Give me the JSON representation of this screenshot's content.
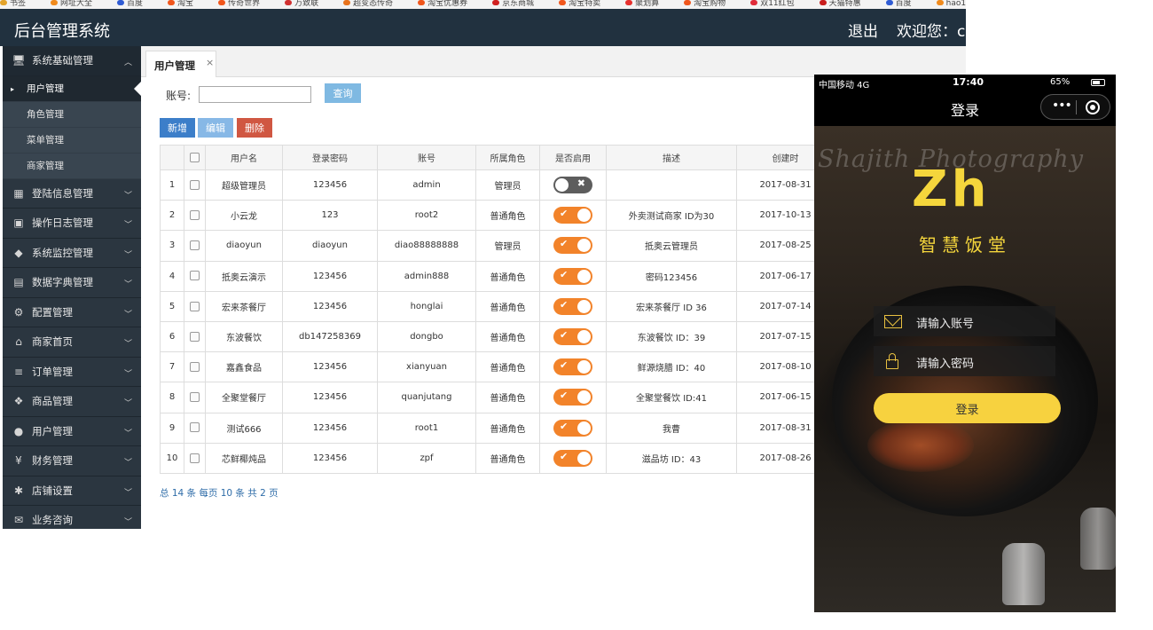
{
  "bookmarks": [
    {
      "label": "书签",
      "color": "#e3a32a"
    },
    {
      "label": "网址大全",
      "color": "#f08a1c"
    },
    {
      "label": "百度",
      "color": "#2f5bd3"
    },
    {
      "label": "淘宝",
      "color": "#f0561c"
    },
    {
      "label": "传奇世界",
      "color": "#f0561c"
    },
    {
      "label": "万致联",
      "color": "#d03030"
    },
    {
      "label": "超变态传奇",
      "color": "#e9731c"
    },
    {
      "label": "淘宝优惠券",
      "color": "#f0561c"
    },
    {
      "label": "京东商城",
      "color": "#d02020"
    },
    {
      "label": "淘宝特卖",
      "color": "#f0561c"
    },
    {
      "label": "聚划算",
      "color": "#e6302d"
    },
    {
      "label": "淘宝购物",
      "color": "#f0561c"
    },
    {
      "label": "双11红包",
      "color": "#e02b3a"
    },
    {
      "label": "天猫特惠",
      "color": "#c81d1d"
    },
    {
      "label": "百度",
      "color": "#2f5bd3"
    },
    {
      "label": "hao123导航",
      "color": "#f08a1c"
    }
  ],
  "header": {
    "title": "后台管理系统",
    "logout": "退出",
    "welcome": "欢迎您：c"
  },
  "sidebar": {
    "groups": [
      {
        "label": "系统基础管理",
        "icon": "monitor-icon",
        "glyph": "🖥",
        "open": true,
        "items": [
          {
            "label": "用户管理",
            "active": true
          },
          {
            "label": "角色管理"
          },
          {
            "label": "菜单管理"
          },
          {
            "label": "商家管理"
          }
        ]
      },
      {
        "label": "登陆信息管理",
        "icon": "calendar-icon",
        "glyph": "▦"
      },
      {
        "label": "操作日志管理",
        "icon": "image-icon",
        "glyph": "▣"
      },
      {
        "label": "系统监控管理",
        "icon": "tag-icon",
        "glyph": "◆"
      },
      {
        "label": "数据字典管理",
        "icon": "book-icon",
        "glyph": "▤"
      },
      {
        "label": "配置管理",
        "icon": "gear-icon",
        "glyph": "⚙"
      },
      {
        "label": "商家首页",
        "icon": "home-icon",
        "glyph": "⌂"
      },
      {
        "label": "订单管理",
        "icon": "list-icon",
        "glyph": "≡"
      },
      {
        "label": "商品管理",
        "icon": "cubes-icon",
        "glyph": "❖"
      },
      {
        "label": "用户管理",
        "icon": "user-icon",
        "glyph": "●"
      },
      {
        "label": "财务管理",
        "icon": "yen-icon",
        "glyph": "¥"
      },
      {
        "label": "店铺设置",
        "icon": "asterisk-icon",
        "glyph": "✱"
      },
      {
        "label": "业务咨询",
        "icon": "chat-icon",
        "glyph": "✉"
      }
    ]
  },
  "tab": {
    "label": "用户管理",
    "close": "×"
  },
  "search": {
    "label": "账号:",
    "value": "",
    "button": "查询"
  },
  "toolbar": {
    "add": "新增",
    "edit": "编辑",
    "delete": "删除"
  },
  "table": {
    "headers": [
      "",
      "",
      "用户名",
      "登录密码",
      "账号",
      "所属角色",
      "是否启用",
      "描述",
      "创建时"
    ],
    "rows": [
      {
        "no": "1",
        "username": "超级管理员",
        "password": "123456",
        "account": "admin",
        "role": "管理员",
        "enabled": false,
        "desc": "",
        "created": "2017-08-31"
      },
      {
        "no": "2",
        "username": "小云龙",
        "password": "123",
        "account": "root2",
        "role": "普通角色",
        "enabled": true,
        "desc": "外卖测试商家 ID为30",
        "created": "2017-10-13"
      },
      {
        "no": "3",
        "username": "diaoyun",
        "password": "diaoyun",
        "account": "diao88888888",
        "role": "管理员",
        "enabled": true,
        "desc": "抵奥云管理员",
        "created": "2017-08-25"
      },
      {
        "no": "4",
        "username": "抵奥云演示",
        "password": "123456",
        "account": "admin888",
        "role": "普通角色",
        "enabled": true,
        "desc": "密码123456",
        "created": "2017-06-17"
      },
      {
        "no": "5",
        "username": "宏来茶餐厅",
        "password": "123456",
        "account": "honglai",
        "role": "普通角色",
        "enabled": true,
        "desc": "宏来茶餐厅 ID 36",
        "created": "2017-07-14"
      },
      {
        "no": "6",
        "username": "东波餐饮",
        "password": "db147258369",
        "account": "dongbo",
        "role": "普通角色",
        "enabled": true,
        "desc": "东波餐饮 ID：39",
        "created": "2017-07-15"
      },
      {
        "no": "7",
        "username": "嘉鑫食品",
        "password": "123456",
        "account": "xianyuan",
        "role": "普通角色",
        "enabled": true,
        "desc": "鲜源烧腊 ID：40",
        "created": "2017-08-10"
      },
      {
        "no": "8",
        "username": "全聚堂餐厅",
        "password": "123456",
        "account": "quanjutang",
        "role": "普通角色",
        "enabled": true,
        "desc": "全聚堂餐饮 ID:41",
        "created": "2017-06-15"
      },
      {
        "no": "9",
        "username": "测试666",
        "password": "123456",
        "account": "root1",
        "role": "普通角色",
        "enabled": true,
        "desc": "我曹",
        "created": "2017-08-31"
      },
      {
        "no": "10",
        "username": "芯鲜椰炖品",
        "password": "123456",
        "account": "zpf",
        "role": "普通角色",
        "enabled": true,
        "desc": "滋品坊 ID：43",
        "created": "2017-08-26"
      }
    ]
  },
  "pager": {
    "text": "总 14 条  每页 10 条  共 2 页"
  },
  "phone": {
    "carrier": "中国移动  4G",
    "time": "17:40",
    "battery": "65%",
    "nav_title": "登录",
    "capsule_dots": "•••",
    "watermark": "Shajith Photography",
    "logo": "Zh",
    "logo_subtitle": "智慧饭堂",
    "account_placeholder": "请输入账号",
    "password_placeholder": "请输入密码",
    "login_button": "登录"
  }
}
